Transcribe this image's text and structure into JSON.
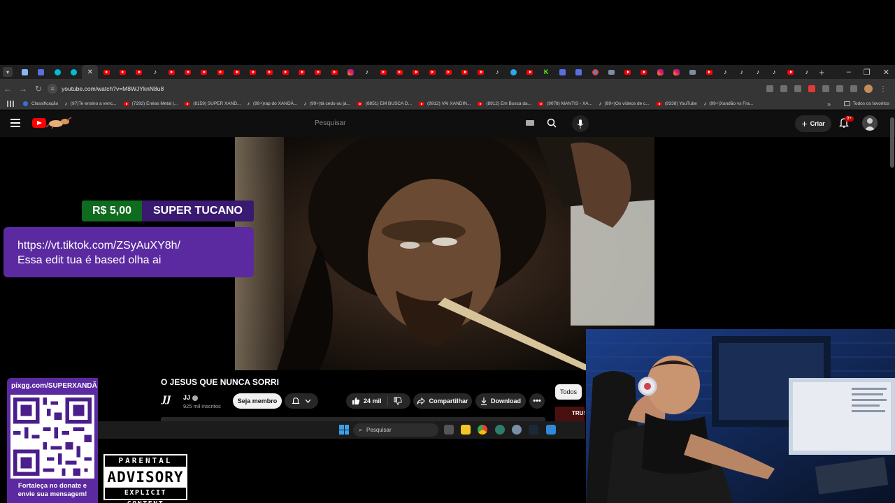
{
  "browser": {
    "tabs": [
      {
        "icon": "dots"
      },
      {
        "icon": "doc"
      },
      {
        "icon": "cyan"
      },
      {
        "icon": "cyan"
      },
      {
        "icon": "close",
        "active": true
      },
      {
        "icon": "yt"
      },
      {
        "icon": "yt"
      },
      {
        "icon": "yt"
      },
      {
        "icon": "tt"
      },
      {
        "icon": "yt"
      },
      {
        "icon": "yt"
      },
      {
        "icon": "yt"
      },
      {
        "icon": "yt"
      },
      {
        "icon": "yt"
      },
      {
        "icon": "yt"
      },
      {
        "icon": "yt"
      },
      {
        "icon": "yt"
      },
      {
        "icon": "yt"
      },
      {
        "icon": "yt"
      },
      {
        "icon": "yt"
      },
      {
        "icon": "ig"
      },
      {
        "icon": "tt"
      },
      {
        "icon": "yt"
      },
      {
        "icon": "yt"
      },
      {
        "icon": "yt"
      },
      {
        "icon": "yt"
      },
      {
        "icon": "yt"
      },
      {
        "icon": "yt"
      },
      {
        "icon": "yt"
      },
      {
        "icon": "tt"
      },
      {
        "icon": "tg"
      },
      {
        "icon": "yt"
      },
      {
        "icon": "kk"
      },
      {
        "icon": "doc"
      },
      {
        "icon": "doc"
      },
      {
        "icon": "g"
      },
      {
        "icon": "win"
      },
      {
        "icon": "yt"
      },
      {
        "icon": "yt"
      },
      {
        "icon": "ig"
      },
      {
        "icon": "ig"
      },
      {
        "icon": "win"
      },
      {
        "icon": "yt"
      },
      {
        "icon": "tt"
      },
      {
        "icon": "tt"
      },
      {
        "icon": "tt"
      },
      {
        "icon": "tt"
      },
      {
        "icon": "yt"
      },
      {
        "icon": "tt"
      }
    ],
    "new_tab_symbol": "+",
    "window_controls": {
      "minimize": "–",
      "restore": "❐",
      "close": "✕"
    },
    "url": "youtube.com/watch?v=M8WJYknN8u8",
    "bookmarks": [
      {
        "label": "Classificação",
        "icon": "blue"
      },
      {
        "label": "(97)Te ensino a venc...",
        "icon": "tt"
      },
      {
        "label": "(7292) Enéas Metal |...",
        "icon": "yt"
      },
      {
        "label": "(8159) SUPER XAND...",
        "icon": "yt"
      },
      {
        "label": "(99+)rap do XANDÃ...",
        "icon": "tt"
      },
      {
        "label": "(99+)tá cedo ou já...",
        "icon": "tt"
      },
      {
        "label": "(8851) EM BUSCA D...",
        "icon": "yt"
      },
      {
        "label": "(8912) VAI XANDIN...",
        "icon": "yt"
      },
      {
        "label": "(8912) Em Busca da...",
        "icon": "yt"
      },
      {
        "label": "(9078) MANTIS - XA...",
        "icon": "yt"
      },
      {
        "label": "(99+)Os vídeos de c...",
        "icon": "tt"
      },
      {
        "label": "(9338) YouTube",
        "icon": "yt"
      },
      {
        "label": "(99+)Xandão vs Fra...",
        "icon": "tt"
      }
    ],
    "bookmarks_more": "»",
    "all_bookmarks": "Todos os favoritos"
  },
  "youtube": {
    "search_placeholder": "Pesquisar",
    "create_label": "Criar",
    "notifications_badge": "9+",
    "video": {
      "title": "O JESUS QUE NUNCA SORRI",
      "channel_logo": "JJ",
      "channel": "JJ",
      "subscribers": "925 mil inscritos",
      "join_label": "Seja membro",
      "likes": "24 mil",
      "share_label": "Compartilhar",
      "download_label": "Download",
      "more_label": "•••"
    },
    "filter_chip": "Todos",
    "related_thumb_text": "TRUS"
  },
  "overlay": {
    "donation_amount": "R$ 5,00",
    "donor_name": "SUPER TUCANO",
    "donation_message_line1": "https://vt.tiktok.com/ZSyAuXY8h/",
    "donation_message_line2": "Essa edit tua é based olha ai",
    "qr_url": "pixgg.com/SUPERXANDÃ",
    "qr_caption_line1": "Fortaleça no donate e",
    "qr_caption_line2": "envie sua mensagem!",
    "parental_top": "PARENTAL",
    "parental_mid": "ADVISORY",
    "parental_bottom": "EXPLICIT CONTENT"
  },
  "taskbar": {
    "search_placeholder": "Pesquisar"
  }
}
